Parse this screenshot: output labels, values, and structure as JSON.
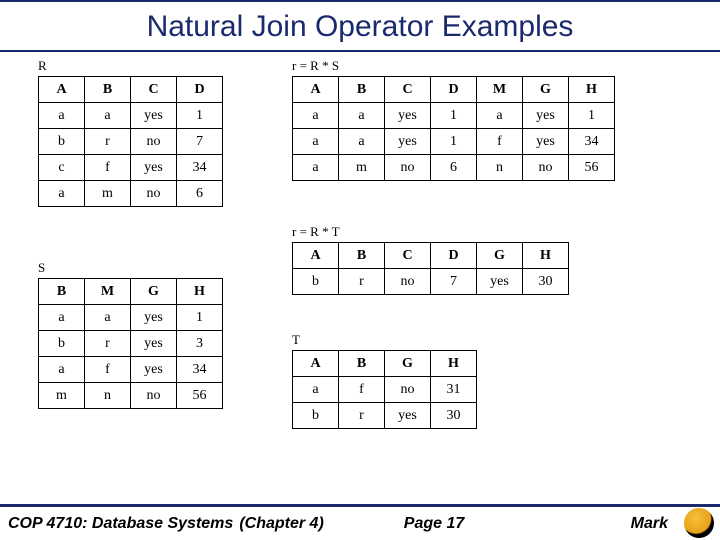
{
  "title": "Natural Join Operator Examples",
  "tables": {
    "R": {
      "label": "R",
      "headers": [
        "A",
        "B",
        "C",
        "D"
      ],
      "rows": [
        [
          "a",
          "a",
          "yes",
          "1"
        ],
        [
          "b",
          "r",
          "no",
          "7"
        ],
        [
          "c",
          "f",
          "yes",
          "34"
        ],
        [
          "a",
          "m",
          "no",
          "6"
        ]
      ]
    },
    "RS": {
      "label": "r = R * S",
      "headers": [
        "A",
        "B",
        "C",
        "D",
        "M",
        "G",
        "H"
      ],
      "rows": [
        [
          "a",
          "a",
          "yes",
          "1",
          "a",
          "yes",
          "1"
        ],
        [
          "a",
          "a",
          "yes",
          "1",
          "f",
          "yes",
          "34"
        ],
        [
          "a",
          "m",
          "no",
          "6",
          "n",
          "no",
          "56"
        ]
      ]
    },
    "RT": {
      "label": "r = R * T",
      "headers": [
        "A",
        "B",
        "C",
        "D",
        "G",
        "H"
      ],
      "rows": [
        [
          "b",
          "r",
          "no",
          "7",
          "yes",
          "30"
        ]
      ]
    },
    "S": {
      "label": "S",
      "headers": [
        "B",
        "M",
        "G",
        "H"
      ],
      "rows": [
        [
          "a",
          "a",
          "yes",
          "1"
        ],
        [
          "b",
          "r",
          "yes",
          "3"
        ],
        [
          "a",
          "f",
          "yes",
          "34"
        ],
        [
          "m",
          "n",
          "no",
          "56"
        ]
      ]
    },
    "T": {
      "label": "T",
      "headers": [
        "A",
        "B",
        "G",
        "H"
      ],
      "rows": [
        [
          "a",
          "f",
          "no",
          "31"
        ],
        [
          "b",
          "r",
          "yes",
          "30"
        ]
      ]
    }
  },
  "footer": {
    "course": "COP 4710: Database Systems",
    "chapter": "(Chapter 4)",
    "page": "Page 17",
    "author": "Mark"
  }
}
